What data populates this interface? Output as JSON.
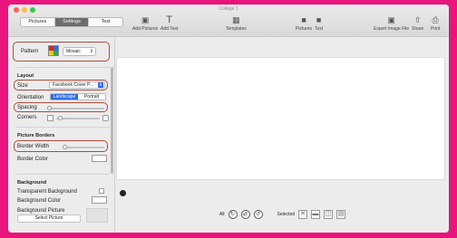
{
  "window": {
    "title": "Collage 1"
  },
  "toolbar": {
    "tabs": [
      "Pictures",
      "Settings",
      "Text"
    ],
    "active_tab": "Settings",
    "add_pictures": "Add Pictures",
    "add_text": "Add Text",
    "templates": "Templates",
    "pictures_lock": "Pictures",
    "text_lock": "Text",
    "export": "Export Image File",
    "share": "Share",
    "print": "Print"
  },
  "sidebar": {
    "pattern_label": "Pattern",
    "pattern_value": "Mosaic",
    "layout_title": "Layout",
    "size_label": "Size",
    "size_value": "Facebook Cover P...",
    "orientation_label": "Orientation",
    "orientation_options": [
      "Landscape",
      "Portrait"
    ],
    "spacing_label": "Spacing",
    "corners_label": "Corners",
    "borders_title": "Picture Borders",
    "border_width_label": "Border Width",
    "border_color_label": "Border Color",
    "background_title": "Background",
    "transparent_bg_label": "Transparent Background",
    "background_color_label": "Background Color",
    "background_picture_label": "Background Picture",
    "select_picture_label": "Select Picture"
  },
  "bottom_bar": {
    "all_label": "All",
    "selected_label": "Selected"
  },
  "colors": {
    "highlight": "#b04a3a",
    "accent": "#2f6de0",
    "frame": "#e8157d"
  }
}
